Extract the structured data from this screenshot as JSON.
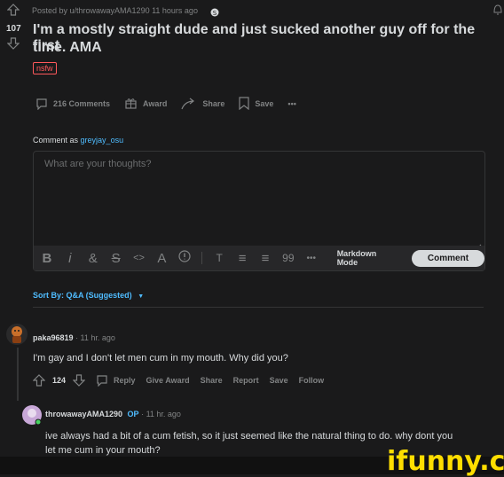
{
  "post": {
    "posted_by": "Posted by u/throwawayAMA1290 11 hours ago",
    "vote_count": "107",
    "title_line1": "I'm a mostly straight dude and just sucked another guy off for the first",
    "title_line2": "time. AMA",
    "nsfw_badge": "nsfw"
  },
  "actions": {
    "comments": "216 Comments",
    "award": "Award",
    "share": "Share",
    "save": "Save",
    "more": "•••"
  },
  "comment_box": {
    "comment_as": "Comment as",
    "username": "greyjay_osu",
    "placeholder": "What are your thoughts?",
    "toolbar_icons": [
      "B",
      "i",
      "&",
      "S",
      "<>",
      "A",
      "!",
      "T",
      "≡",
      "≡",
      "99",
      "•••"
    ],
    "markdown_mode": "Markdown Mode",
    "comment_button": "Comment"
  },
  "sort": {
    "label": "Sort By: Q&A (Suggested)",
    "caret": "▼"
  },
  "comments": [
    {
      "author": "paka96819",
      "time": "· 11 hr. ago",
      "body": "I'm gay and I don't let men cum in my mouth. Why did you?",
      "votes": "124",
      "actions": [
        "Reply",
        "Give Award",
        "Share",
        "Report",
        "Save",
        "Follow"
      ]
    },
    {
      "author": "throwawayAMA1290",
      "op_badge": "OP",
      "time": "· 11 hr. ago",
      "body_line1": "ive always had a bit of a cum fetish, so it just seemed like the natural thing to do. why dont you",
      "body_line2": "let me cum in your mouth?"
    }
  ],
  "watermark": "ifunny.co",
  "colors": {
    "background": "#1a1a1b",
    "accent_link": "#4fbcff",
    "nsfw": "#ff585b",
    "watermark": "#ffde00"
  }
}
